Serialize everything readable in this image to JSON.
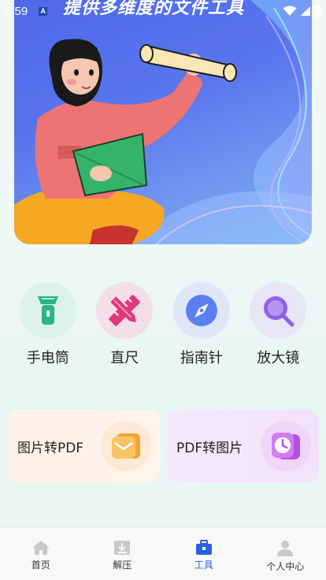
{
  "status": {
    "time": "5:59",
    "notification": "A"
  },
  "banner": {
    "title": "提供多维度的文件工具"
  },
  "tools": [
    {
      "label": "手电筒",
      "icon": "flashlight-icon",
      "bg": "#dcf1ec"
    },
    {
      "label": "直尺",
      "icon": "ruler-pencil-icon",
      "bg": "#f3dfe8"
    },
    {
      "label": "指南针",
      "icon": "compass-icon",
      "bg": "#e1e6f7"
    },
    {
      "label": "放大镜",
      "icon": "magnifier-icon",
      "bg": "#e8e5f5"
    }
  ],
  "converters": [
    {
      "label": "图片转PDF",
      "icon": "envelope-icon"
    },
    {
      "label": "PDF转图片",
      "icon": "clock-card-icon"
    }
  ],
  "nav": [
    {
      "label": "首页",
      "icon": "home-icon",
      "active": false
    },
    {
      "label": "解压",
      "icon": "unzip-icon",
      "active": false
    },
    {
      "label": "工具",
      "icon": "toolbox-icon",
      "active": true
    },
    {
      "label": "个人中心",
      "icon": "user-icon",
      "active": false
    }
  ],
  "colors": {
    "accent": "#2b5fe0",
    "banner": "#5a76ee"
  }
}
